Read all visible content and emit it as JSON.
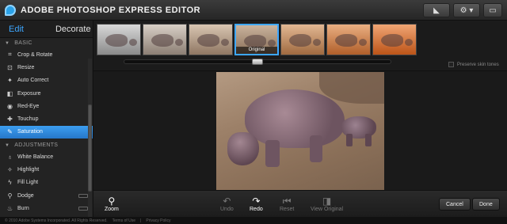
{
  "header": {
    "title": "ADOBE PHOTOSHOP EXPRESS EDITOR"
  },
  "tabs": {
    "edit": "Edit",
    "decorate": "Decorate"
  },
  "sidebar": {
    "basic_heading": "BASIC",
    "basic_items": [
      "Crop & Rotate",
      "Resize",
      "Auto Correct",
      "Exposure",
      "Red-Eye",
      "Touchup",
      "Saturation"
    ],
    "adjust_heading": "ADJUSTMENTS",
    "adjust_items": [
      "White Balance",
      "Highlight",
      "Fill Light",
      "Dodge",
      "Burn"
    ]
  },
  "thumbnails": {
    "selected_caption": "Original",
    "count": 7,
    "selected_index": 3
  },
  "slider": {
    "value": 0.5
  },
  "preserve_skin_tones": "Preserve skin tones",
  "toolbar": {
    "zoom": "Zoom",
    "undo": "Undo",
    "redo": "Redo",
    "reset": "Reset",
    "view_original": "View Original",
    "cancel": "Cancel",
    "done": "Done"
  },
  "footer": {
    "copyright": "© 2010 Adobe Systems Incorporated. All Rights Reserved.",
    "terms": "Terms of Use",
    "privacy": "Privacy Policy"
  },
  "colors": {
    "accent": "#3da7ff",
    "selection": "#2a86d8"
  }
}
